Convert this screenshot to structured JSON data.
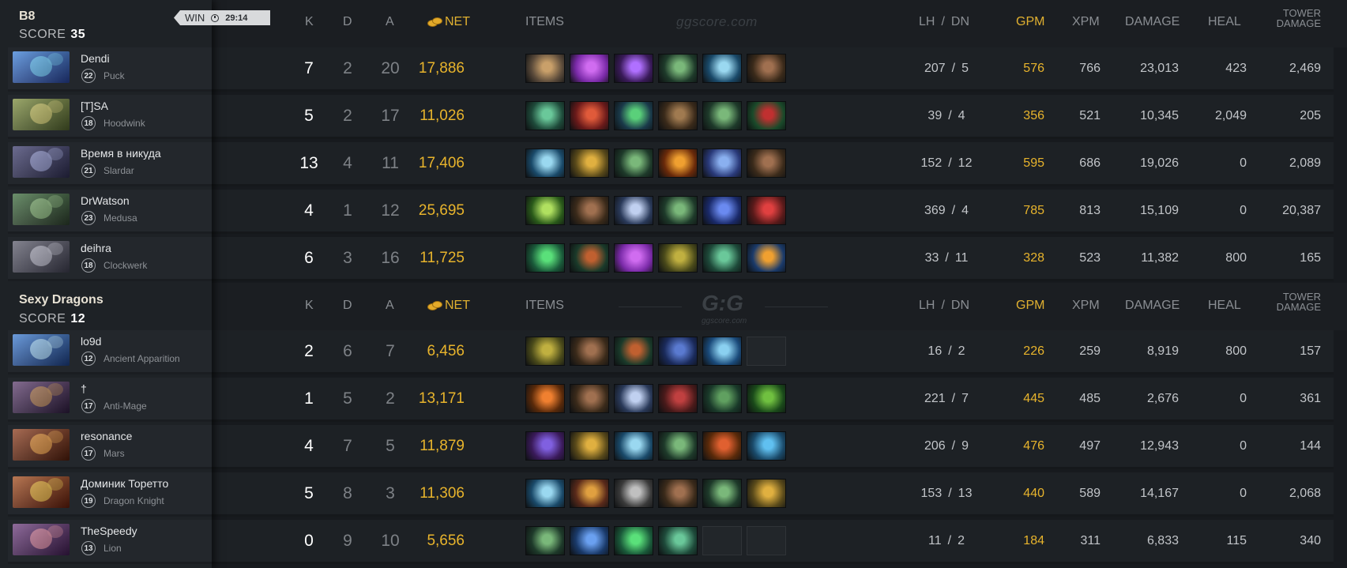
{
  "teams": [
    {
      "name": "B8",
      "score_label": "SCORE",
      "score": "35",
      "result": "WIN",
      "duration": "29:14",
      "watermark": "ggscore.com",
      "columns": {
        "k": "K",
        "d": "D",
        "a": "A",
        "net": "NET",
        "items": "ITEMS",
        "lh": "LH",
        "slash": "/",
        "dn": "DN",
        "gpm": "GPM",
        "xpm": "XPM",
        "damage": "DAMAGE",
        "heal": "HEAL",
        "tower1": "TOWER",
        "tower2": "DAMAGE"
      },
      "players": [
        {
          "name": "Dendi",
          "level": "22",
          "hero": "Puck",
          "k": "7",
          "d": "2",
          "a": "20",
          "net": "17,886",
          "lh": "207",
          "dn": "5",
          "gpm": "576",
          "xpm": "766",
          "damage": "23,013",
          "heal": "423",
          "tower": "2,469",
          "portrait": [
            "#3a7fd6",
            "#6fd0ff",
            "#243c8c"
          ],
          "items": [
            [
              "#5a4a3a",
              "#c9a06a"
            ],
            [
              "#7a2aa8",
              "#d06cf0"
            ],
            [
              "#3a1a5a",
              "#b070ff"
            ],
            [
              "#1e3a2a",
              "#7ab87a"
            ],
            [
              "#1a4a6a",
              "#9ad8f0"
            ],
            [
              "#3a2a1a",
              "#a07050"
            ]
          ]
        },
        {
          "name": "[T]SA",
          "level": "18",
          "hero": "Hoodwink",
          "k": "5",
          "d": "2",
          "a": "17",
          "net": "11,026",
          "lh": "39",
          "dn": "4",
          "gpm": "356",
          "xpm": "521",
          "damage": "10,345",
          "heal": "2,049",
          "tower": "205",
          "portrait": [
            "#7a8a3a",
            "#d8d070",
            "#4a5a2a"
          ],
          "items": [
            [
              "#1e4a3a",
              "#6ac89a"
            ],
            [
              "#6a1a1a",
              "#e05a3a"
            ],
            [
              "#1a3a4a",
              "#5ad07a"
            ],
            [
              "#3a2a1a",
              "#a07a50"
            ],
            [
              "#1e3a2a",
              "#7ab87a"
            ],
            [
              "#1a4a2a",
              "#c03030"
            ]
          ]
        },
        {
          "name": "Время в никуда",
          "level": "21",
          "hero": "Slardar",
          "k": "13",
          "d": "4",
          "a": "11",
          "net": "17,406",
          "lh": "152",
          "dn": "12",
          "gpm": "595",
          "xpm": "686",
          "damage": "19,026",
          "heal": "0",
          "tower": "2,089",
          "portrait": [
            "#3a3a6a",
            "#9aa0d8",
            "#2a2a4a"
          ],
          "items": [
            [
              "#1a4a6a",
              "#9ad8f0"
            ],
            [
              "#5a4a1a",
              "#e0b040"
            ],
            [
              "#1e3a2a",
              "#7ab87a"
            ],
            [
              "#6a2a0a",
              "#f0a030"
            ],
            [
              "#2a3a7a",
              "#8ab0f0"
            ],
            [
              "#3a2a1a",
              "#a07050"
            ]
          ]
        },
        {
          "name": "DrWatson",
          "level": "23",
          "hero": "Medusa",
          "k": "4",
          "d": "1",
          "a": "12",
          "net": "25,695",
          "lh": "369",
          "dn": "4",
          "gpm": "785",
          "xpm": "813",
          "damage": "15,109",
          "heal": "0",
          "tower": "20,387",
          "portrait": [
            "#3a6a3a",
            "#90c080",
            "#2a3a2a"
          ],
          "items": [
            [
              "#2a5a1a",
              "#b0e060"
            ],
            [
              "#3a2a1a",
              "#a07050"
            ],
            [
              "#2a3a5a",
              "#c0d0f0"
            ],
            [
              "#1e3a2a",
              "#7ab87a"
            ],
            [
              "#1a2a6a",
              "#6a8af0"
            ],
            [
              "#5a1a1a",
              "#e04040"
            ]
          ]
        },
        {
          "name": "deihra",
          "level": "18",
          "hero": "Clockwerk",
          "k": "6",
          "d": "3",
          "a": "16",
          "net": "11,725",
          "lh": "33",
          "dn": "11",
          "gpm": "328",
          "xpm": "523",
          "damage": "11,382",
          "heal": "800",
          "tower": "165",
          "portrait": [
            "#5a5a6a",
            "#c0c0d0",
            "#3a3a4a"
          ],
          "items": [
            [
              "#1a5a3a",
              "#5ae07a"
            ],
            [
              "#1a3a2a",
              "#c06030"
            ],
            [
              "#7a2aa8",
              "#d06cf0"
            ],
            [
              "#4a4a1a",
              "#c0b040"
            ],
            [
              "#1e4a3a",
              "#6ac89a"
            ],
            [
              "#1a3a6a",
              "#f0a030"
            ]
          ]
        }
      ]
    },
    {
      "name": "Sexy Dragons",
      "score_label": "SCORE",
      "score": "12",
      "logo": "G:G",
      "logo_sub": "ggscore.com",
      "columns": {
        "k": "K",
        "d": "D",
        "a": "A",
        "net": "NET",
        "items": "ITEMS",
        "lh": "LH",
        "slash": "/",
        "dn": "DN",
        "gpm": "GPM",
        "xpm": "XPM",
        "damage": "DAMAGE",
        "heal": "HEAL",
        "tower1": "TOWER",
        "tower2": "DAMAGE"
      },
      "players": [
        {
          "name": "lo9d",
          "level": "12",
          "hero": "Ancient Apparition",
          "k": "2",
          "d": "6",
          "a": "7",
          "net": "6,456",
          "lh": "16",
          "dn": "2",
          "gpm": "226",
          "xpm": "259",
          "damage": "8,919",
          "heal": "800",
          "tower": "157",
          "portrait": [
            "#3a7ad0",
            "#b0e0ff",
            "#1a3a7a"
          ],
          "items": [
            [
              "#4a4a1a",
              "#c0b040"
            ],
            [
              "#3a2a1a",
              "#a07050"
            ],
            [
              "#1a3a2a",
              "#c06030"
            ],
            [
              "#1a2a5a",
              "#5a7ad0"
            ],
            [
              "#1a4a7a",
              "#8ad0f0"
            ],
            null
          ]
        },
        {
          "name": "†",
          "level": "17",
          "hero": "Anti-Mage",
          "k": "1",
          "d": "5",
          "a": "2",
          "net": "13,171",
          "lh": "221",
          "dn": "7",
          "gpm": "445",
          "xpm": "485",
          "damage": "2,676",
          "heal": "0",
          "tower": "361",
          "portrait": [
            "#5a3a6a",
            "#c08a50",
            "#2a1a3a"
          ],
          "items": [
            [
              "#5a2a0a",
              "#f08030"
            ],
            [
              "#3a2a1a",
              "#a07050"
            ],
            [
              "#2a3a5a",
              "#c0d0f0"
            ],
            [
              "#4a1a1a",
              "#c04040"
            ],
            [
              "#1a3a2a",
              "#60a060"
            ],
            [
              "#1a4a1a",
              "#70c040"
            ]
          ]
        },
        {
          "name": "resonance",
          "level": "17",
          "hero": "Mars",
          "k": "4",
          "d": "7",
          "a": "5",
          "net": "11,879",
          "lh": "206",
          "dn": "9",
          "gpm": "476",
          "xpm": "497",
          "damage": "12,943",
          "heal": "0",
          "tower": "144",
          "portrait": [
            "#8a3a1a",
            "#f0a040",
            "#4a1a0a"
          ],
          "items": [
            [
              "#3a1a5a",
              "#8060e0"
            ],
            [
              "#5a4a1a",
              "#e0b040"
            ],
            [
              "#1a4a6a",
              "#9ad8f0"
            ],
            [
              "#1e3a2a",
              "#7ab87a"
            ],
            [
              "#5a2a0a",
              "#e06030"
            ],
            [
              "#1a4a6a",
              "#60c0f0"
            ]
          ]
        },
        {
          "name": "Доминик Торетто",
          "level": "19",
          "hero": "Dragon Knight",
          "k": "5",
          "d": "8",
          "a": "3",
          "net": "11,306",
          "lh": "153",
          "dn": "13",
          "gpm": "440",
          "xpm": "589",
          "damage": "14,167",
          "heal": "0",
          "tower": "2,068",
          "portrait": [
            "#a04a1a",
            "#f0c040",
            "#5a1a0a"
          ],
          "items": [
            [
              "#1a4a6a",
              "#9ad8f0"
            ],
            [
              "#5a2a1a",
              "#e0a040"
            ],
            [
              "#3a3a3a",
              "#c0c0c0"
            ],
            [
              "#3a2a1a",
              "#a07050"
            ],
            [
              "#1e3a2a",
              "#7ab87a"
            ],
            [
              "#5a4a1a",
              "#e0b040"
            ]
          ]
        },
        {
          "name": "TheSpeedy",
          "level": "13",
          "hero": "Lion",
          "k": "0",
          "d": "9",
          "a": "10",
          "net": "5,656",
          "lh": "11",
          "dn": "2",
          "gpm": "184",
          "xpm": "311",
          "damage": "6,833",
          "heal": "115",
          "tower": "340",
          "portrait": [
            "#6a3a7a",
            "#e08aa0",
            "#3a1a4a"
          ],
          "items": [
            [
              "#1e3a2a",
              "#7ab87a"
            ],
            [
              "#1a3a6a",
              "#6aa0f0"
            ],
            [
              "#1a5a3a",
              "#5ae07a"
            ],
            [
              "#1e4a3a",
              "#6ac89a"
            ],
            null,
            null
          ]
        }
      ]
    }
  ]
}
